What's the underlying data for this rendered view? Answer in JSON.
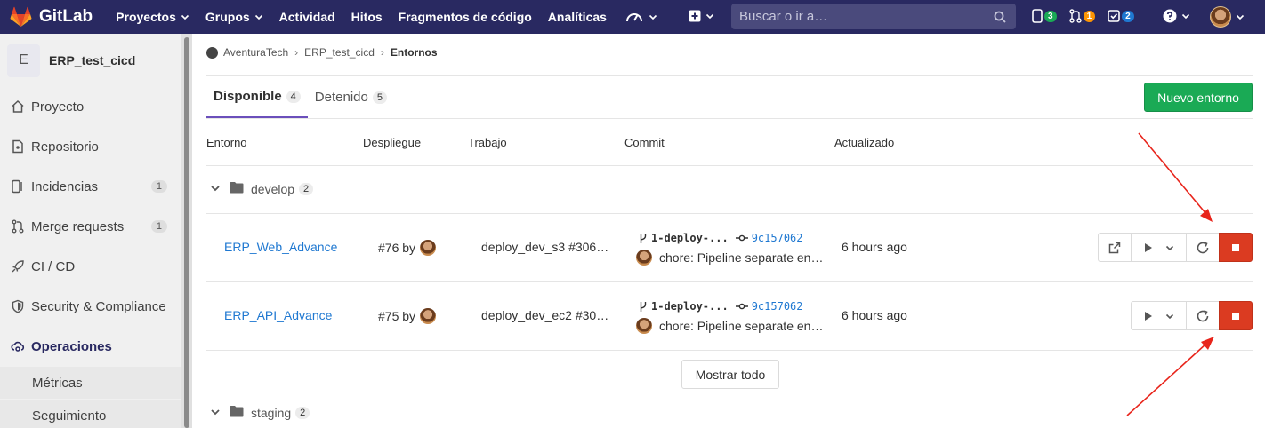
{
  "topbar": {
    "brand": "GitLab",
    "nav": [
      "Proyectos",
      "Grupos",
      "Actividad",
      "Hitos",
      "Fragmentos de código",
      "Analíticas"
    ],
    "search_placeholder": "Buscar o ir a…",
    "badges": {
      "issues": "3",
      "merge_requests": "1",
      "todos": "2"
    },
    "colors": {
      "bar": "#292961",
      "issues_badge": "#1aaa55",
      "mr_badge": "#fc9403",
      "todos_badge": "#1f78d1"
    }
  },
  "sidebar": {
    "project_letter": "E",
    "project_name": "ERP_test_cicd",
    "items": [
      {
        "label": "Proyecto",
        "icon": "home-icon"
      },
      {
        "label": "Repositorio",
        "icon": "doc-icon"
      },
      {
        "label": "Incidencias",
        "icon": "issues-icon",
        "count": "1"
      },
      {
        "label": "Merge requests",
        "icon": "merge-request-icon",
        "count": "1"
      },
      {
        "label": "CI / CD",
        "icon": "rocket-icon"
      },
      {
        "label": "Security & Compliance",
        "icon": "shield-icon"
      },
      {
        "label": "Operaciones",
        "icon": "cloud-gear-icon",
        "active": true
      }
    ],
    "sub_items": [
      "Métricas",
      "Seguimiento"
    ]
  },
  "breadcrumb": {
    "group": "AventuraTech",
    "project": "ERP_test_cicd",
    "current": "Entornos"
  },
  "tabs": [
    {
      "label": "Disponible",
      "count": "4",
      "active": true
    },
    {
      "label": "Detenido",
      "count": "5",
      "active": false
    }
  ],
  "new_env_button": "Nuevo entorno",
  "table": {
    "headers": [
      "Entorno",
      "Despliegue",
      "Trabajo",
      "Commit",
      "Actualizado"
    ],
    "groups": [
      {
        "name": "develop",
        "count": "2",
        "rows": [
          {
            "env": "ERP_Web_Advance",
            "deploy": "#76 by",
            "job": "deploy_dev_s3 #306…",
            "ref": "1-deploy-...",
            "sha": "9c157062",
            "message": "chore: Pipeline separate en…",
            "updated": "6 hours ago",
            "has_external": true
          },
          {
            "env": "ERP_API_Advance",
            "deploy": "#75 by",
            "job": "deploy_dev_ec2 #30…",
            "ref": "1-deploy-...",
            "sha": "9c157062",
            "message": "chore: Pipeline separate en…",
            "updated": "6 hours ago",
            "has_external": false
          }
        ]
      },
      {
        "name": "staging",
        "count": "2"
      }
    ],
    "show_all": "Mostrar todo"
  },
  "accent": {
    "stop_button": "#db3b21",
    "link": "#1f78d1",
    "tab_underline": "#6b4fbb",
    "annotation_arrow": "#e8241b"
  }
}
